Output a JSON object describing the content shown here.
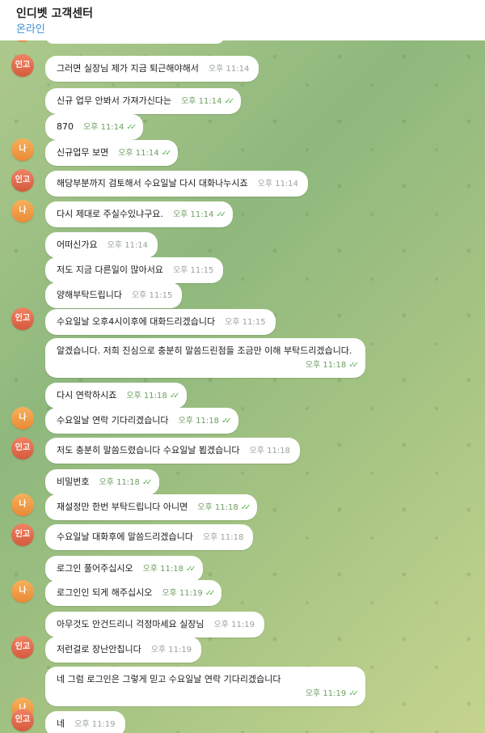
{
  "header": {
    "title": "인디벳 고객센터",
    "status": "온라인"
  },
  "avatars": {
    "agent": "인고",
    "me": "나"
  },
  "colors": {
    "bubble": "#ffffff",
    "read_check": "#5fb35a",
    "status": "#3a8fd6",
    "avatar_agent": "#d65a3e",
    "avatar_me": "#ea8a36"
  },
  "messages": [
    {
      "text": "그러면 실장님 제가 지금 퇴근해야해서",
      "time": "오후 11:14",
      "read": false,
      "sender": "agent"
    },
    {
      "text": "신규 업무 안봐서 가져가신다는",
      "time": "오후 11:14",
      "read": true,
      "sender": "me"
    },
    {
      "text": "870",
      "time": "오후 11:14",
      "read": true,
      "sender": "me"
    },
    {
      "text": "신규업무 보면",
      "time": "오후 11:14",
      "read": true,
      "sender": "me"
    },
    {
      "text": "해당부분까지 검토해서 수요일날 다시 대화나누시죠",
      "time": "오후 11:14",
      "read": false,
      "sender": "agent"
    },
    {
      "text": "다시 제대로 주실수있냐구요.",
      "time": "오후 11:14",
      "read": true,
      "sender": "me"
    },
    {
      "text": "어떠신가요",
      "time": "오후 11:14",
      "read": false,
      "sender": "agent"
    },
    {
      "text": "저도 지금 다른일이 많아서요",
      "time": "오후 11:15",
      "read": false,
      "sender": "agent"
    },
    {
      "text": "양해부탁드립니다",
      "time": "오후 11:15",
      "read": false,
      "sender": "agent"
    },
    {
      "text": "수요일날 오후4시이후에 대화드리겠습니다",
      "time": "오후 11:15",
      "read": false,
      "sender": "agent"
    },
    {
      "text": "알겠습니다. 저희 진심으로 충분히 말씀드린점들 조금만 이해 부탁드리겠습니다.",
      "time": "오후 11:18",
      "read": true,
      "sender": "me"
    },
    {
      "text": "다시 연락하시죠",
      "time": "오후 11:18",
      "read": true,
      "sender": "me"
    },
    {
      "text": "수요일날 연락 기다리겠습니다",
      "time": "오후 11:18",
      "read": true,
      "sender": "me"
    },
    {
      "text": "저도 충분히 말씀드렸습니다 수요일날 뵙겠습니다",
      "time": "오후 11:18",
      "read": false,
      "sender": "agent"
    },
    {
      "text": "비밀번호",
      "time": "오후 11:18",
      "read": true,
      "sender": "me"
    },
    {
      "text": "재설정만 한번 부탁드립니다 아니면",
      "time": "오후 11:18",
      "read": true,
      "sender": "me"
    },
    {
      "text": "수요일날 대화후에 말씀드리겠습니다",
      "time": "오후 11:18",
      "read": false,
      "sender": "agent"
    },
    {
      "text": "로그인 풀어주십시오",
      "time": "오후 11:18",
      "read": true,
      "sender": "me"
    },
    {
      "text": "로그인인 되게 해주십시오",
      "time": "오후 11:19",
      "read": true,
      "sender": "me"
    },
    {
      "text": "아무것도 안건드리니 걱정마세요 실장님",
      "time": "오후 11:19",
      "read": false,
      "sender": "agent"
    },
    {
      "text": "저런걸로 장난안칩니다",
      "time": "오후 11:19",
      "read": false,
      "sender": "agent"
    },
    {
      "text": "네 그럼 로그인은 그렇게 믿고 수요일날 연락 기다리겠습니다",
      "time": "오후 11:19",
      "read": true,
      "sender": "me"
    },
    {
      "text": "네",
      "time": "오후 11:19",
      "read": false,
      "sender": "agent"
    }
  ]
}
